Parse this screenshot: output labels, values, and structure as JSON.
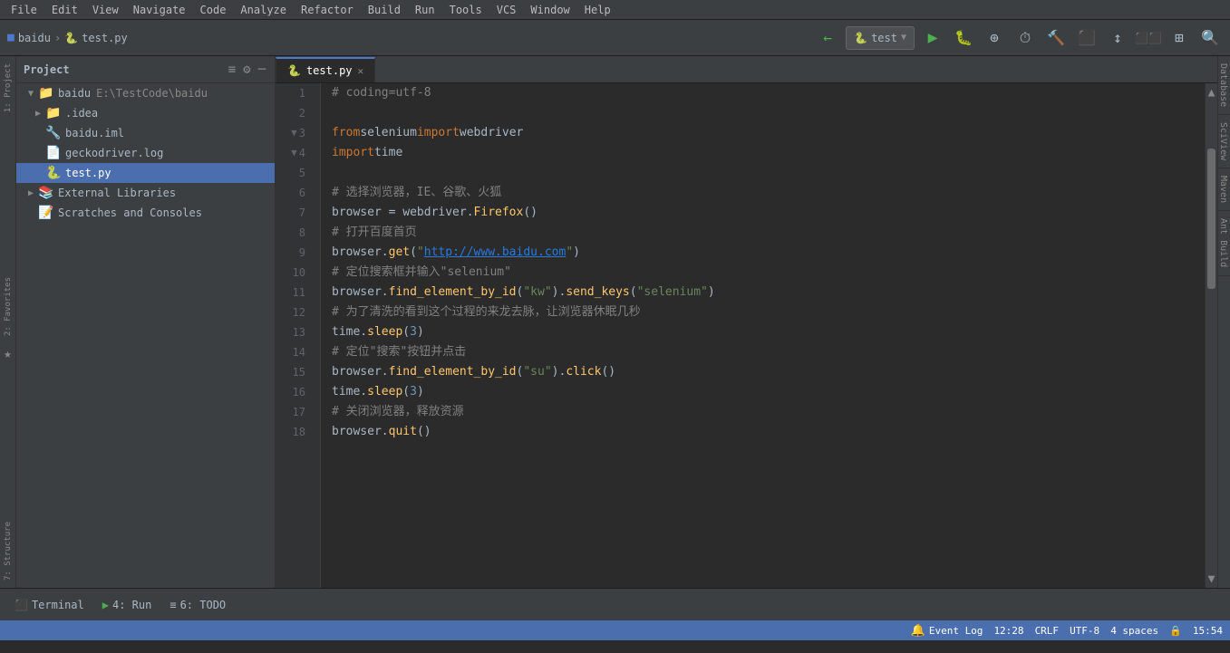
{
  "menubar": {
    "items": [
      "File",
      "Edit",
      "View",
      "Navigate",
      "Code",
      "Analyze",
      "Refactor",
      "Build",
      "Run",
      "Tools",
      "VCS",
      "Window",
      "Help"
    ]
  },
  "toolbar": {
    "breadcrumb1": "baidu",
    "breadcrumb2": "test.py",
    "run_config": "test",
    "run_config_dropdown": "▼"
  },
  "tabs": [
    {
      "label": "test.py",
      "active": true,
      "icon": "🐍"
    }
  ],
  "sidebar": {
    "title": "Project",
    "items": [
      {
        "level": 0,
        "icon": "📁",
        "label": "baidu",
        "sublabel": "E:\\TestCode\\baidu",
        "arrow": "▼",
        "expanded": true
      },
      {
        "level": 1,
        "icon": "📁",
        "label": ".idea",
        "arrow": "▶",
        "expanded": false
      },
      {
        "level": 1,
        "icon": "🔧",
        "label": "baidu.iml",
        "arrow": "",
        "expanded": false
      },
      {
        "level": 1,
        "icon": "📄",
        "label": "geckodriver.log",
        "arrow": "",
        "expanded": false
      },
      {
        "level": 1,
        "icon": "🐍",
        "label": "test.py",
        "arrow": "",
        "selected": true
      },
      {
        "level": 0,
        "icon": "📚",
        "label": "External Libraries",
        "arrow": "▶",
        "expanded": false
      },
      {
        "level": 0,
        "icon": "📝",
        "label": "Scratches and Consoles",
        "arrow": "",
        "expanded": false
      }
    ]
  },
  "code": {
    "lines": [
      {
        "num": 1,
        "fold": false,
        "content": "# coding=utf-8"
      },
      {
        "num": 2,
        "fold": false,
        "content": ""
      },
      {
        "num": 3,
        "fold": true,
        "content": "from selenium import webdriver"
      },
      {
        "num": 4,
        "fold": true,
        "content": "import time"
      },
      {
        "num": 5,
        "fold": false,
        "content": ""
      },
      {
        "num": 6,
        "fold": false,
        "content": "    # 选择浏览器，IE、谷歌、火狐"
      },
      {
        "num": 7,
        "fold": false,
        "content": "    browser = webdriver.Firefox()"
      },
      {
        "num": 8,
        "fold": false,
        "content": "    # 打开百度首页"
      },
      {
        "num": 9,
        "fold": false,
        "content": "    browser.get(\"http://www.baidu.com\")"
      },
      {
        "num": 10,
        "fold": false,
        "content": "    # 定位搜索框并输入\"selenium\""
      },
      {
        "num": 11,
        "fold": false,
        "content": "    browser.find_element_by_id(\"kw\").send_keys(\"selenium\")"
      },
      {
        "num": 12,
        "fold": false,
        "content": "    # 为了清洗的看到这个过程的来龙去脉，让浏览器休眠几秒"
      },
      {
        "num": 13,
        "fold": false,
        "content": "    time.sleep(3)"
      },
      {
        "num": 14,
        "fold": false,
        "content": "    # 定位\"搜索\"按钮并点击"
      },
      {
        "num": 15,
        "fold": false,
        "content": "    browser.find_element_by_id(\"su\").click()"
      },
      {
        "num": 16,
        "fold": false,
        "content": "    time.sleep(3)"
      },
      {
        "num": 17,
        "fold": false,
        "content": "    # 关闭浏览器，释放资源"
      },
      {
        "num": 18,
        "fold": false,
        "content": "    browser.quit()"
      }
    ]
  },
  "right_tabs": [
    "Database",
    "SciView",
    "Maven",
    "Ant Build"
  ],
  "bottom_tabs": [
    "Terminal",
    "4: Run",
    "6: TODO"
  ],
  "status_bar": {
    "line_col": "12:28",
    "crlf": "CRLF",
    "encoding": "UTF-8",
    "indent": "4 spaces",
    "lock_icon": "🔒",
    "event_log": "Event Log",
    "time": "15:54"
  }
}
